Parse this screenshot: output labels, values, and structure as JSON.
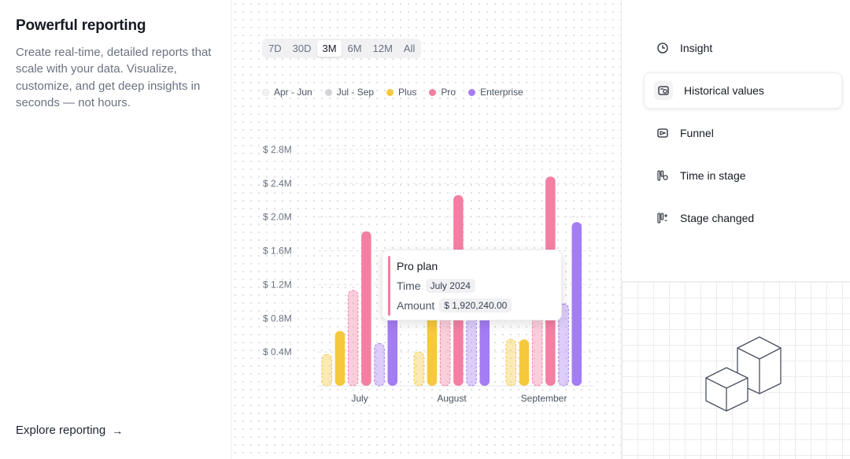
{
  "left": {
    "title": "Powerful reporting",
    "description": "Create real-time, detailed reports that scale with your data. Visualize, customize, and get deep insights in seconds — not hours.",
    "link_label": "Explore reporting",
    "link_arrow": "→"
  },
  "ranges": [
    "7D",
    "30D",
    "3M",
    "6M",
    "12M",
    "All"
  ],
  "active_range": "3M",
  "legend": [
    {
      "label": "Apr - Jun",
      "color": "#f3f3f5"
    },
    {
      "label": "Jul - Sep",
      "color": "#d4d4d8"
    },
    {
      "label": "Plus",
      "color": "#f5c93b"
    },
    {
      "label": "Pro",
      "color": "#f47fa3"
    },
    {
      "label": "Enterprise",
      "color": "#a47cf3"
    }
  ],
  "tooltip": {
    "title": "Pro plan",
    "time_label": "Time",
    "time_value": "July 2024",
    "amount_label": "Amount",
    "amount_value": "$ 1,920,240.00"
  },
  "menu": [
    {
      "label": "Insight",
      "icon": "clock-icon",
      "active": false
    },
    {
      "label": "Historical values",
      "icon": "history-icon",
      "active": true
    },
    {
      "label": "Funnel",
      "icon": "funnel-icon",
      "active": false
    },
    {
      "label": "Time in stage",
      "icon": "stage-time-icon",
      "active": false
    },
    {
      "label": "Stage changed",
      "icon": "stage-changed-icon",
      "active": false
    }
  ],
  "chart_data": {
    "type": "bar",
    "categories": [
      "July",
      "August",
      "September"
    ],
    "y_ticks": [
      "$ 0.4M",
      "$ 0.8M",
      "$ 1.2M",
      "$ 1.6M",
      "$ 2.0M",
      "$ 2.4M",
      "$ 2.8M"
    ],
    "ylim": [
      0,
      2.8
    ],
    "series": [
      {
        "name": "Plus",
        "period": "Apr - Jun",
        "color": "#f5c93b",
        "dashed": true,
        "values": [
          0.37,
          0.4,
          0.55
        ]
      },
      {
        "name": "Plus",
        "period": "Jul - Sep",
        "color": "#f5c93b",
        "dashed": false,
        "values": [
          0.65,
          0.9,
          0.55
        ]
      },
      {
        "name": "Pro",
        "period": "Apr - Jun",
        "color": "#f47fa3",
        "dashed": true,
        "values": [
          1.13,
          0.9,
          1.6
        ]
      },
      {
        "name": "Pro",
        "period": "Jul - Sep",
        "color": "#f47fa3",
        "dashed": false,
        "values": [
          1.83,
          2.26,
          2.48
        ]
      },
      {
        "name": "Enterprise",
        "period": "Apr - Jun",
        "color": "#a47cf3",
        "dashed": true,
        "values": [
          0.5,
          0.85,
          0.97
        ]
      },
      {
        "name": "Enterprise",
        "period": "Jul - Sep",
        "color": "#a47cf3",
        "dashed": false,
        "values": [
          1.0,
          0.9,
          1.94
        ]
      }
    ]
  }
}
